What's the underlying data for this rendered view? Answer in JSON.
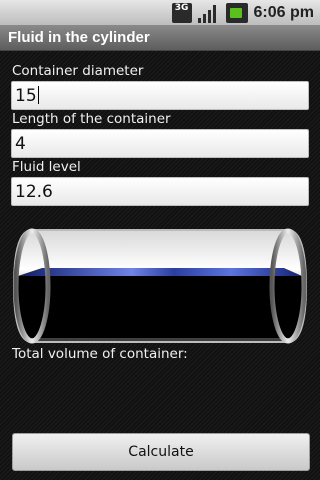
{
  "status_bar": {
    "network_label": "3G",
    "time": "6:06 pm",
    "icons": [
      "3g-icon",
      "signal-icon",
      "battery-icon"
    ]
  },
  "app": {
    "title": "Fluid in the cylinder"
  },
  "form": {
    "diameter_label": "Container diameter",
    "diameter_value": "15",
    "length_label": "Length of the container",
    "length_value": "4",
    "fluid_label": "Fluid level",
    "fluid_value": "12.6"
  },
  "result": {
    "total_label": "Total volume of container:"
  },
  "actions": {
    "calculate_label": "Calculate"
  },
  "colors": {
    "fluid": "#2a3fa0",
    "title_bar": "#6e6e6e",
    "status_bar": "#d0d0d0"
  }
}
